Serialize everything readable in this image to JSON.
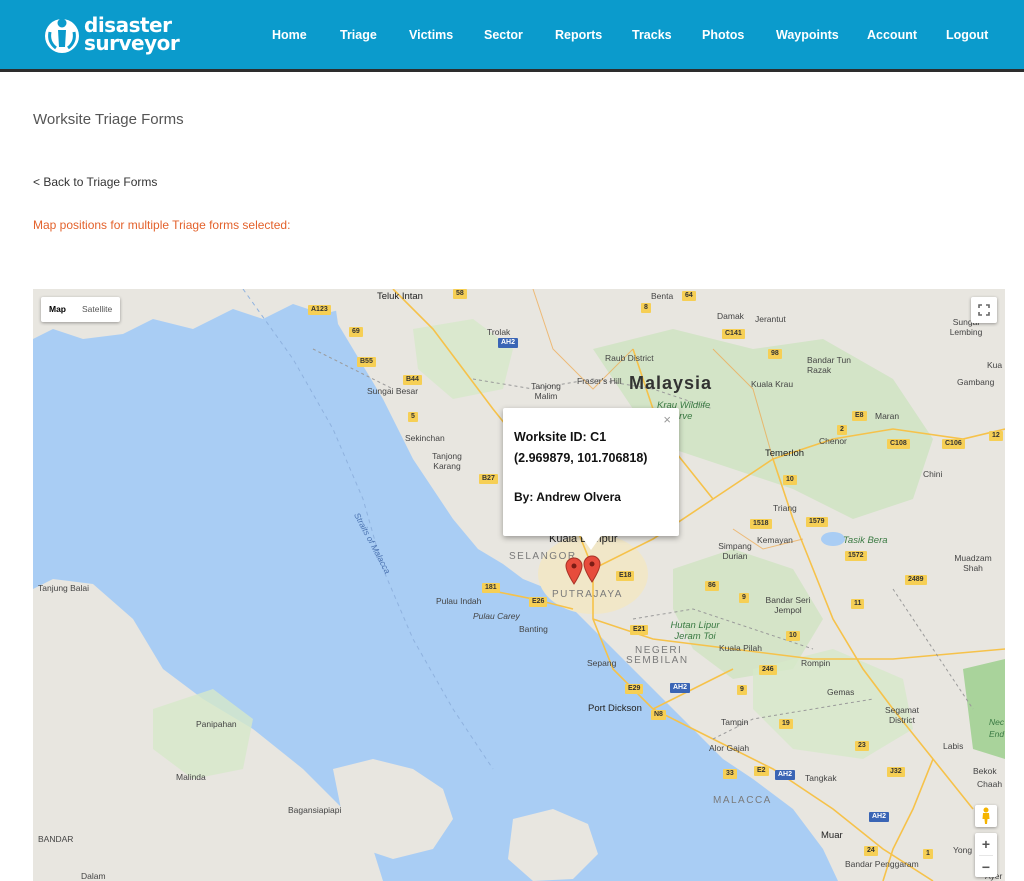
{
  "brand": {
    "line1": "disaster",
    "line2": "surveyor"
  },
  "nav": [
    "Home",
    "Triage",
    "Victims",
    "Sector",
    "Reports",
    "Tracks",
    "Photos",
    "Waypoints",
    "Account",
    "Logout"
  ],
  "page": {
    "title": "Worksite Triage Forms",
    "back_link": "< Back to Triage Forms",
    "notice": "Map positions for multiple Triage forms selected:"
  },
  "map": {
    "type_options": [
      "Map",
      "Satellite"
    ],
    "selected_type": "Map",
    "zoom_in": "+",
    "zoom_out": "−",
    "infowindow": {
      "close": "×",
      "line1": "Worksite ID: C1",
      "line2": "(2.969879, 101.706818)",
      "line3": "By: Andrew Olvera"
    },
    "labels": {
      "country": "Malaysia",
      "selangor": "SELANGOR",
      "putrajaya": "PUTRAJAYA",
      "negeri": "NEGERI",
      "sembilan": "SEMBILAN",
      "malacca": "MALACCA",
      "strait": "Straits of Malacca",
      "teluk_intan": "Teluk Intan",
      "trolak": "Trolak",
      "benta": "Benta",
      "damak": "Damak",
      "jerantut": "Jerantut",
      "sungai_lembing": "Sungai Lembing",
      "raub": "Raub District",
      "frasers": "Fraser's Hill",
      "tanjong_malim": "Tanjong Malim",
      "sungai_besar": "Sungai Besar",
      "kuala_krau": "Kuala Krau",
      "bandar_tun_razak": "Bandar Tun Razak",
      "gambang": "Gambang",
      "krau_wildlife": "Krau Wildlife Reserve",
      "maran": "Maran",
      "chenor": "Chenor",
      "temerloh": "Temerloh",
      "sekinchan": "Sekinchan",
      "tanjong_karang": "Tanjong Karang",
      "chini": "Chini",
      "triang": "Triang",
      "kemayan": "Kemayan",
      "tasik_bera": "Tasik Bera",
      "kuala_lumpur": "Kuala Lumpur",
      "simpang_durian": "Simpang Durian",
      "muadzam_shah": "Muadzam Shah",
      "tanjung_balai": "Tanjung Balai",
      "pulau_indah": "Pulau Indah",
      "pulau_carey": "Pulau Carey",
      "banting": "Banting",
      "bandar_seri_jempol": "Bandar Seri Jempol",
      "hutan_lipur": "Hutan Lipur Jeram Toi",
      "kuala_pilah": "Kuala Pilah",
      "rompin": "Rompin",
      "sepang": "Sepang",
      "gemas": "Gemas",
      "port_dickson": "Port Dickson",
      "segamat": "Segamat District",
      "panipahan": "Panipahan",
      "tampin": "Tampin",
      "alor_gajah": "Alor Gajah",
      "labis": "Labis",
      "bekok": "Bekok",
      "malinda": "Malinda",
      "tangkak": "Tangkak",
      "chaah": "Chaah",
      "bagansiapiapi": "Bagansiapiapi",
      "bandar": "BANDAR",
      "muar": "Muar",
      "bandar_penggaram": "Bandar Penggaram",
      "yong_peng": "Yong Peng",
      "dalam": "Dalam",
      "kua": "Kua",
      "nec": "Nec",
      "end": "End",
      "ayer": "Ayer"
    },
    "shields": [
      "58",
      "64",
      "8",
      "A123",
      "C141",
      "69",
      "AH2",
      "98",
      "B55",
      "B44",
      "5",
      "E8",
      "2",
      "C108",
      "C106",
      "12",
      "B27",
      "10",
      "1518",
      "1579",
      "1572",
      "181",
      "E26",
      "E18",
      "86",
      "9",
      "2489",
      "11",
      "E21",
      "10",
      "246",
      "9",
      "E29",
      "AH2",
      "N8",
      "19",
      "23",
      "33",
      "E2",
      "AH2",
      "J32",
      "AH2",
      "24",
      "1"
    ]
  }
}
